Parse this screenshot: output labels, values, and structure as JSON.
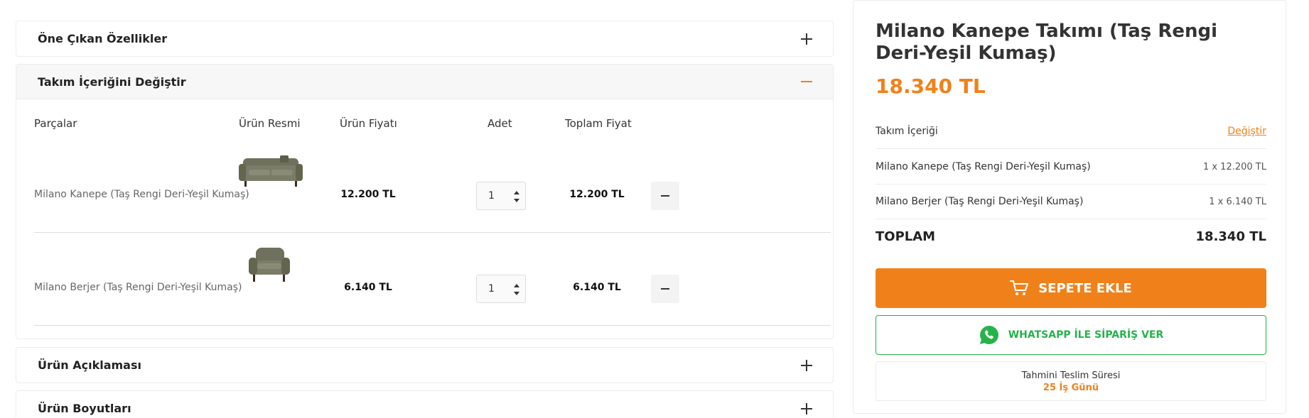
{
  "accordions": {
    "features": {
      "title": "Öne Çıkan Özellikler"
    },
    "set": {
      "title": "Takım İçeriğini Değiştir"
    },
    "description": {
      "title": "Ürün Açıklaması"
    },
    "dimensions": {
      "title": "Ürün Boyutları"
    }
  },
  "table": {
    "headers": {
      "parts": "Parçalar",
      "image": "Ürün Resmi",
      "price": "Ürün Fiyatı",
      "qty": "Adet",
      "total": "Toplam Fiyat"
    },
    "rows": [
      {
        "name": "Milano Kanepe (Taş Rengi Deri-Yeşil Kumaş)",
        "price": "12.200 TL",
        "qty": "1",
        "total": "12.200 TL"
      },
      {
        "name": "Milano Berjer (Taş Rengi Deri-Yeşil Kumaş)",
        "price": "6.140 TL",
        "qty": "1",
        "total": "6.140 TL"
      }
    ]
  },
  "summary": {
    "title": "Milano Kanepe Takımı (Taş Rengi Deri-Yeşil Kumaş)",
    "price": "18.340 TL",
    "set_label": "Takım İçeriği",
    "change_link": "Değiştir",
    "items": [
      {
        "name": "Milano Kanepe (Taş Rengi Deri-Yeşil Kumaş)",
        "qty_price": "1 x 12.200 TL"
      },
      {
        "name": "Milano Berjer (Taş Rengi Deri-Yeşil Kumaş)",
        "qty_price": "1 x 6.140 TL"
      }
    ],
    "total_label": "TOPLAM",
    "total_value": "18.340 TL",
    "add_to_cart": "SEPETE EKLE",
    "whatsapp": "WHATSAPP İLE SİPARİŞ VER",
    "delivery_label": "Tahmini Teslim Süresi",
    "delivery_value": "25 İş Günü"
  },
  "colors": {
    "accent": "#f0811a",
    "whatsapp": "#25b34a"
  },
  "icons": {
    "expand": "plus-icon",
    "collapse": "minus-icon",
    "cart": "cart-icon",
    "whatsapp": "whatsapp-icon"
  }
}
